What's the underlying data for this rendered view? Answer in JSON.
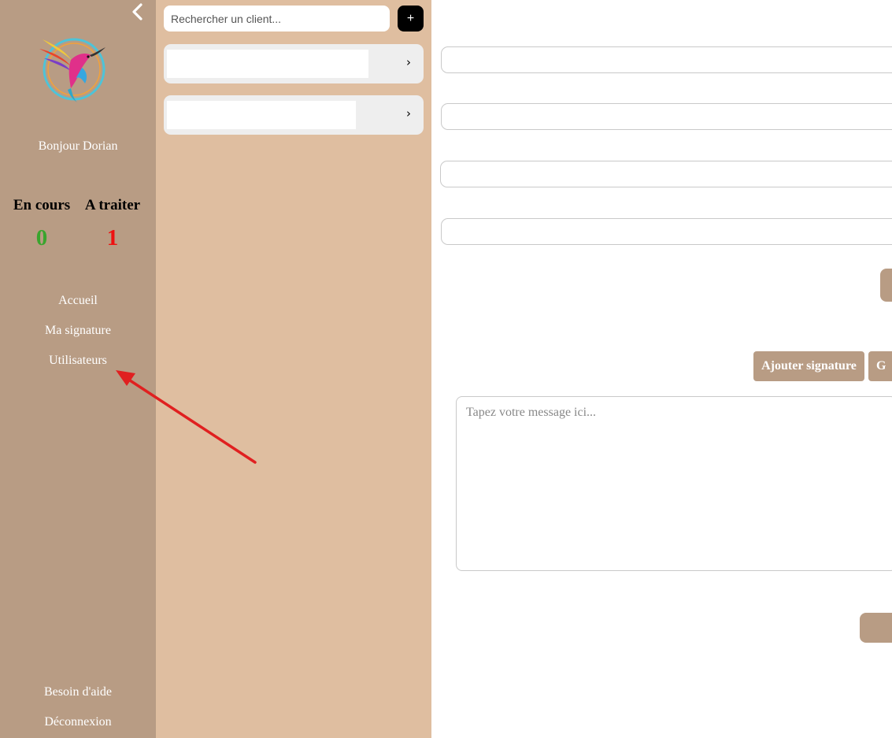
{
  "sidebar": {
    "greeting": "Bonjour Dorian",
    "stats": {
      "en_cours": {
        "label": "En cours",
        "value": "0",
        "color": "#3aa52e"
      },
      "a_traiter": {
        "label": "A traiter",
        "value": "1",
        "color": "#ee1111"
      }
    },
    "nav": {
      "accueil": "Accueil",
      "ma_signature": "Ma signature",
      "utilisateurs": "Utilisateurs",
      "besoin_aide": "Besoin d'aide",
      "deconnexion": "Déconnexion"
    }
  },
  "clients": {
    "search_placeholder": "Rechercher un client...",
    "add_label": "+",
    "items": [
      {
        "chevron": "›"
      },
      {
        "chevron": "›"
      }
    ]
  },
  "main": {
    "buttons": {
      "add_signature": "Ajouter signature",
      "second": "G"
    },
    "message_placeholder": "Tapez votre message ici..."
  },
  "colors": {
    "sidebar_bg": "#b89c84",
    "clients_bg": "#dfbea0",
    "accent": "#b89c84",
    "annotation": "#e02020"
  }
}
